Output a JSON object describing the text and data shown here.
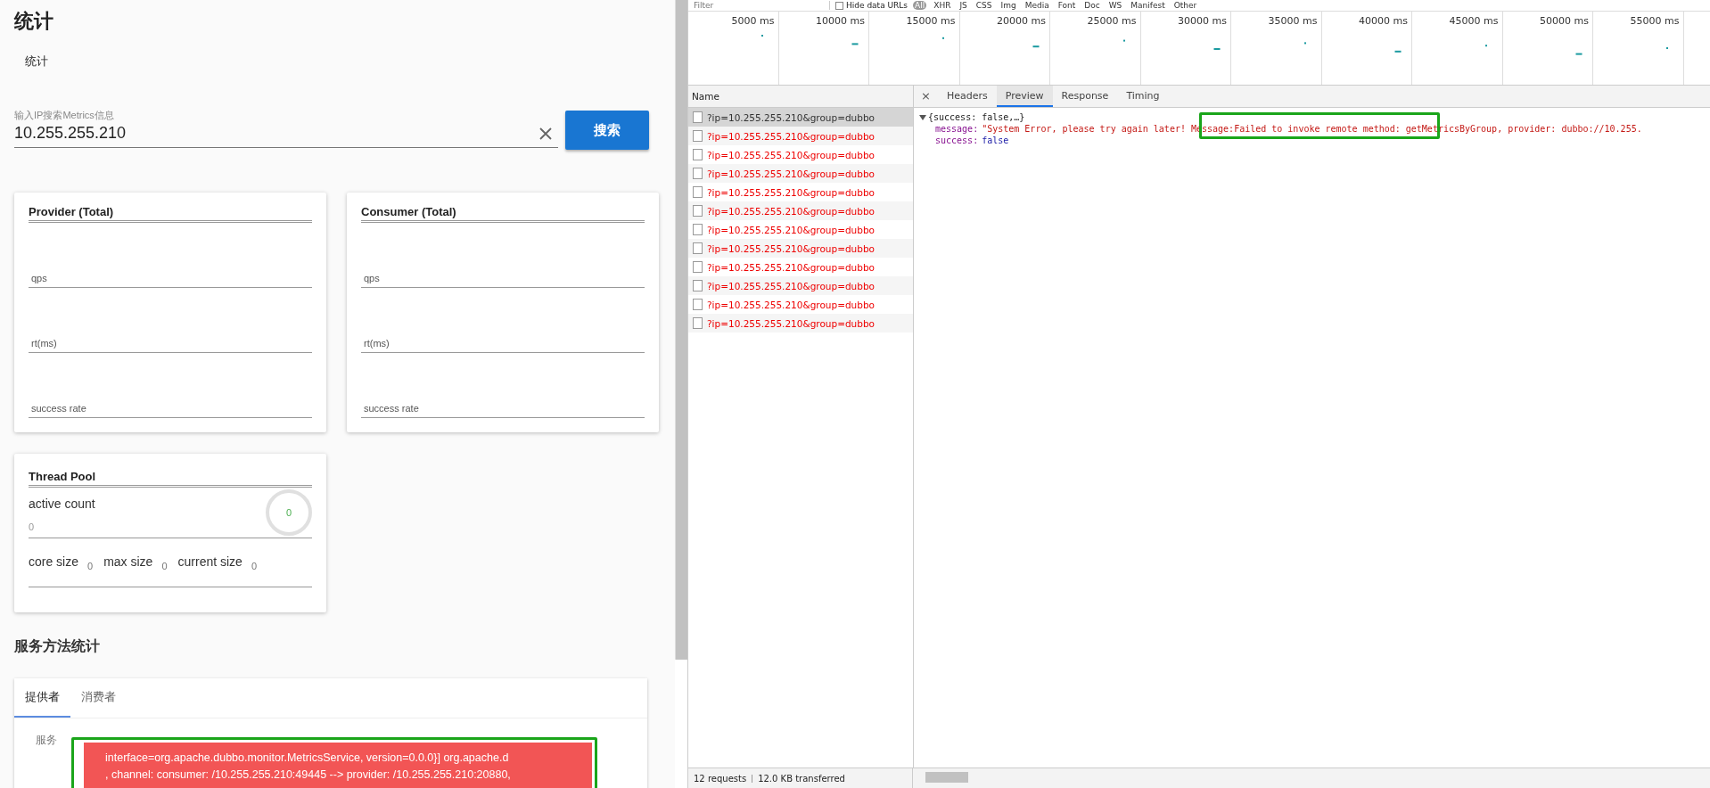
{
  "page": {
    "title": "统计",
    "breadcrumb": "统计"
  },
  "search": {
    "label": "输入IP搜索Metrics信息",
    "value": "10.255.255.210",
    "button": "搜索"
  },
  "metric_cards": [
    {
      "title": "Provider (Total)",
      "fields": [
        "qps",
        "rt(ms)",
        "success rate"
      ]
    },
    {
      "title": "Consumer (Total)",
      "fields": [
        "qps",
        "rt(ms)",
        "success rate"
      ]
    }
  ],
  "thread_pool": {
    "title": "Thread Pool",
    "active_label": "active count",
    "active_value": "0",
    "gauge_value": "0",
    "sizes": [
      {
        "label": "core size",
        "value": "0"
      },
      {
        "label": "max size",
        "value": "0"
      },
      {
        "label": "current size",
        "value": "0"
      }
    ]
  },
  "method_stats": {
    "title": "服务方法统计",
    "tabs": [
      {
        "label": "提供者",
        "selected": true
      },
      {
        "label": "消费者",
        "selected": false
      }
    ],
    "columns": [
      "服务"
    ]
  },
  "toast": {
    "lines": [
      "interface=org.apache.dubbo.monitor.MetricsService, version=0.0.0}] org.apache.d",
      ", channel: consumer: /10.255.255.210:49445 --> provider: /10.255.255.210:20880,"
    ]
  },
  "devtools": {
    "filter_placeholder": "Filter",
    "hide_data_urls": {
      "label": "Hide data URLs",
      "checked": false
    },
    "type_filters": [
      {
        "label": "All",
        "selected": true
      },
      {
        "label": "XHR",
        "selected": false
      },
      {
        "label": "JS",
        "selected": false
      },
      {
        "label": "CSS",
        "selected": false
      },
      {
        "label": "Img",
        "selected": false
      },
      {
        "label": "Media",
        "selected": false
      },
      {
        "label": "Font",
        "selected": false
      },
      {
        "label": "Doc",
        "selected": false
      },
      {
        "label": "WS",
        "selected": false
      },
      {
        "label": "Manifest",
        "selected": false
      },
      {
        "label": "Other",
        "selected": false
      }
    ],
    "timeline_ticks": [
      "5000 ms",
      "10000 ms",
      "15000 ms",
      "20000 ms",
      "25000 ms",
      "30000 ms",
      "35000 ms",
      "40000 ms",
      "45000 ms",
      "50000 ms",
      "55000 ms"
    ],
    "name_header": "Name",
    "requests": [
      {
        "name": "?ip=10.255.255.210&group=dubbo",
        "selected": true,
        "failed": true
      },
      {
        "name": "?ip=10.255.255.210&group=dubbo",
        "selected": false,
        "failed": true
      },
      {
        "name": "?ip=10.255.255.210&group=dubbo",
        "selected": false,
        "failed": true
      },
      {
        "name": "?ip=10.255.255.210&group=dubbo",
        "selected": false,
        "failed": true
      },
      {
        "name": "?ip=10.255.255.210&group=dubbo",
        "selected": false,
        "failed": true
      },
      {
        "name": "?ip=10.255.255.210&group=dubbo",
        "selected": false,
        "failed": true
      },
      {
        "name": "?ip=10.255.255.210&group=dubbo",
        "selected": false,
        "failed": true
      },
      {
        "name": "?ip=10.255.255.210&group=dubbo",
        "selected": false,
        "failed": true
      },
      {
        "name": "?ip=10.255.255.210&group=dubbo",
        "selected": false,
        "failed": true
      },
      {
        "name": "?ip=10.255.255.210&group=dubbo",
        "selected": false,
        "failed": true
      },
      {
        "name": "?ip=10.255.255.210&group=dubbo",
        "selected": false,
        "failed": true
      },
      {
        "name": "?ip=10.255.255.210&group=dubbo",
        "selected": false,
        "failed": true
      }
    ],
    "close_symbol": "×",
    "detail_tabs": [
      {
        "label": "Headers",
        "selected": false
      },
      {
        "label": "Preview",
        "selected": true
      },
      {
        "label": "Response",
        "selected": false
      },
      {
        "label": "Timing",
        "selected": false
      }
    ],
    "preview": {
      "summary": "{success: false,…}",
      "props": [
        {
          "key": "message:",
          "value": "\"System Error, please try again later! Message:Failed to invoke remote method: getMetricsByGroup, provider: dubbo://10.255.",
          "kind": "string"
        },
        {
          "key": "success:",
          "value": "false",
          "kind": "boolean"
        }
      ]
    },
    "status": {
      "requests": "12 requests",
      "transferred": "12.0 KB transferred"
    }
  }
}
